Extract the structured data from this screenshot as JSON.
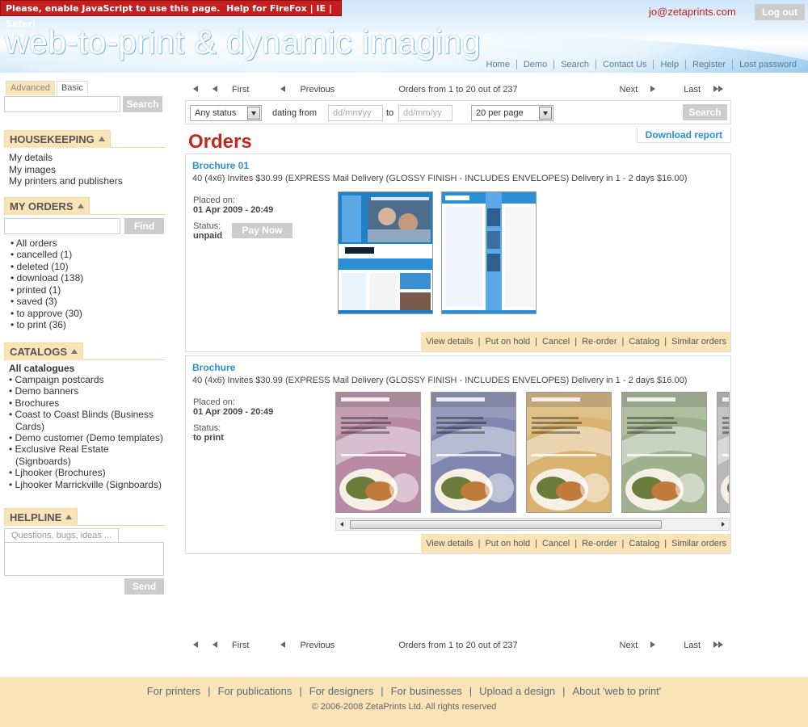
{
  "header": {
    "js_warning": "Please, enable JavaScript to use this page.",
    "help_text": "Help for FireFox | IE | Safari",
    "logo_text": "web-to-print & dynamic imaging",
    "user_email": "jo@zetaprints.com",
    "logout_label": "Log out",
    "nav": [
      "Home",
      "Demo",
      "Search",
      "Contact Us",
      "Help",
      "Register",
      "Lost password"
    ]
  },
  "sidebar": {
    "tabs": [
      "Advanced",
      "Basic"
    ],
    "search_label": "Search",
    "housekeeping": {
      "title": "HOUSEKEEPING",
      "items": [
        "My details",
        "My images",
        "My printers and publishers"
      ]
    },
    "my_orders": {
      "title": "MY ORDERS",
      "find_label": "Find",
      "items": [
        "All orders",
        "cancelled (1)",
        "deleted (10)",
        "download (138)",
        "printed (1)",
        "saved (3)",
        "to approve (30)",
        "to print (36)"
      ]
    },
    "catalogs": {
      "title": "CATALOGS",
      "all_label": "All catalogues",
      "items": [
        "Campaign postcards",
        "Demo banners",
        "Brochures",
        "Coast to Coast Blinds (Business Cards)",
        "Demo customer (Demo templates)",
        "Exclusive Real Estate (Signboards)",
        "Ljhooker (Brochures)",
        "Ljhooker Marrickville (Signboards)"
      ]
    },
    "helpline": {
      "title": "HELPLINE",
      "placeholder": "Questions, bugs, ideas ...",
      "send_label": "Send"
    }
  },
  "main": {
    "pager": {
      "first": "First",
      "previous": "Previous",
      "summary": "Orders from 1 to 20 out of 237",
      "summary_bottom": "Orders from 1 to 20 out of 237",
      "next": "Next",
      "last": "Last"
    },
    "filters": {
      "status": "Any status",
      "dating_from": "dating from",
      "date_placeholder": "dd/mm/yy",
      "to": "to",
      "per_page": "20 per page",
      "search_label": "Search"
    },
    "title": "Orders",
    "download_report": "Download report",
    "action_labels": [
      "View details",
      "Put on hold",
      "Cancel",
      "Re-order",
      "Catalog",
      "Similar orders"
    ],
    "orders": [
      {
        "name": "Brochure 01",
        "description": "40 (4x6) Invites $30.99 (EXPRESS Mail Delivery (GLOSSY FINISH - INCLUDES ENVELOPES) Delivery in 1 - 2 days $16.00)",
        "placed_label": "Placed on:",
        "placed_on": "01 Apr 2009 - 20:49",
        "status_label": "Status:",
        "status": "unpaid",
        "pay_now": "Pay Now"
      },
      {
        "name": "Brochure",
        "description": "40 (4x6) Invites $30.99 (EXPRESS Mail Delivery (GLOSSY FINISH - INCLUDES ENVELOPES) Delivery in 1 - 2 days $16.00)",
        "placed_label": "Placed on:",
        "placed_on": "01 Apr 2009 - 20:49",
        "status_label": "Status:",
        "status": "to print",
        "restaurant_thumb_colors": [
          "#b88aa4",
          "#7f86b0",
          "#d9b36f",
          "#9fb08c",
          "#b8b8b8"
        ]
      }
    ]
  },
  "footer": {
    "links": [
      "For printers",
      "For publications",
      "For designers",
      "For businesses",
      "Upload a design",
      "About 'web to print'"
    ],
    "copyright": "© 2006-2008 ZetaPrints Ltd. All rights reserved"
  }
}
